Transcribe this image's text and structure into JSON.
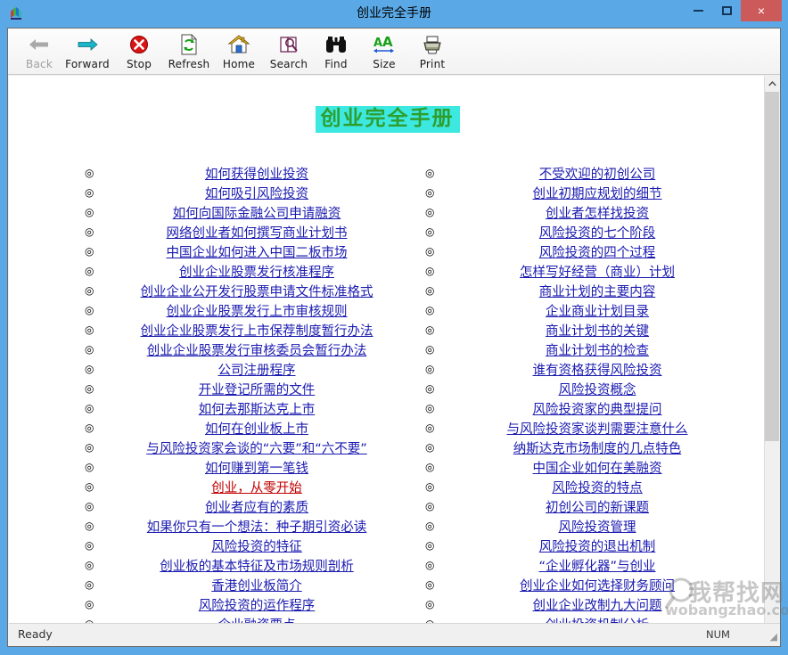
{
  "window": {
    "title": "创业完全手册",
    "icon": "html-help-book-icon",
    "minimize_label": "–",
    "maximize_label": "□",
    "close_label": "×"
  },
  "toolbar": {
    "items": [
      {
        "label": "Back",
        "icon": "arrow-left-icon",
        "disabled": true
      },
      {
        "label": "Forward",
        "icon": "arrow-right-icon",
        "disabled": false
      },
      {
        "label": "Stop",
        "icon": "stop-x-icon",
        "disabled": false
      },
      {
        "label": "Refresh",
        "icon": "refresh-page-icon",
        "disabled": false
      },
      {
        "label": "Home",
        "icon": "home-icon",
        "disabled": false
      },
      {
        "label": "Search",
        "icon": "search-book-icon",
        "disabled": false
      },
      {
        "label": "Find",
        "icon": "binoculars-icon",
        "disabled": false
      },
      {
        "label": "Size",
        "icon": "font-size-icon",
        "disabled": false
      },
      {
        "label": "Print",
        "icon": "printer-icon",
        "disabled": false
      }
    ]
  },
  "document": {
    "heading": "创业完全手册",
    "heading_background": "#3ce8e0",
    "heading_color": "#2f9e2f",
    "link_color": "#1a1ab0",
    "visited_link_color": "#c00000",
    "bullet_glyph": "◎",
    "left_column": [
      {
        "text": "如何获得创业投资",
        "visited": false
      },
      {
        "text": "如何吸引风险投资",
        "visited": false
      },
      {
        "text": "如何向国际金融公司申请融资",
        "visited": false
      },
      {
        "text": "网络创业者如何撰写商业计划书",
        "visited": false
      },
      {
        "text": "中国企业如何进入中国二板市场",
        "visited": false
      },
      {
        "text": "创业企业股票发行核准程序",
        "visited": false
      },
      {
        "text": "创业企业公开发行股票申请文件标准格式",
        "visited": false
      },
      {
        "text": "创业企业股票发行上市审核规则",
        "visited": false
      },
      {
        "text": "创业企业股票发行上市保荐制度暂行办法",
        "visited": false
      },
      {
        "text": "创业企业股票发行审核委员会暂行办法",
        "visited": false
      },
      {
        "text": "公司注册程序",
        "visited": false
      },
      {
        "text": "开业登记所需的文件",
        "visited": false
      },
      {
        "text": "如何去那斯达克上市",
        "visited": false
      },
      {
        "text": "如何在创业板上市",
        "visited": false
      },
      {
        "text": "与风险投资家会谈的“六要”和“六不要”",
        "visited": false
      },
      {
        "text": "如何赚到第一笔钱",
        "visited": false
      },
      {
        "text": "创业，从零开始",
        "visited": true
      },
      {
        "text": "创业者应有的素质",
        "visited": false
      },
      {
        "text": "如果你只有一个想法：种子期引资必读",
        "visited": false
      },
      {
        "text": "风险投资的特征",
        "visited": false
      },
      {
        "text": "创业板的基本特征及市场规则剖析",
        "visited": false
      },
      {
        "text": "香港创业板简介",
        "visited": false
      },
      {
        "text": "风险投资的运作程序",
        "visited": false
      },
      {
        "text": "企业融资要点",
        "visited": false
      }
    ],
    "right_column": [
      {
        "text": "不受欢迎的初创公司",
        "visited": false
      },
      {
        "text": "创业初期应规划的细节",
        "visited": false
      },
      {
        "text": "创业者怎样找投资",
        "visited": false
      },
      {
        "text": "风险投资的七个阶段",
        "visited": false
      },
      {
        "text": "风险投资的四个过程",
        "visited": false
      },
      {
        "text": "怎样写好经营（商业）计划",
        "visited": false
      },
      {
        "text": "商业计划的主要内容",
        "visited": false
      },
      {
        "text": "企业商业计划目录",
        "visited": false
      },
      {
        "text": "商业计划书的关键",
        "visited": false
      },
      {
        "text": "商业计划书的检查",
        "visited": false
      },
      {
        "text": "谁有资格获得风险投资",
        "visited": false
      },
      {
        "text": "风险投资概念",
        "visited": false
      },
      {
        "text": "风险投资家的典型提问",
        "visited": false
      },
      {
        "text": "与风险投资家谈判需要注意什么",
        "visited": false
      },
      {
        "text": "纳斯达克市场制度的几点特色",
        "visited": false
      },
      {
        "text": "中国企业如何在美融资",
        "visited": false
      },
      {
        "text": "风险投资的特点",
        "visited": false
      },
      {
        "text": "初创公司的新课题",
        "visited": false
      },
      {
        "text": "风险投资管理",
        "visited": false
      },
      {
        "text": "风险投资的退出机制",
        "visited": false
      },
      {
        "text": "“企业孵化器”与创业",
        "visited": false
      },
      {
        "text": "创业企业如何选择财务顾问",
        "visited": false
      },
      {
        "text": "创业企业改制九大问题",
        "visited": false
      },
      {
        "text": "创业投资机制分析",
        "visited": false
      }
    ]
  },
  "scrollbar": {
    "up_arrow": "▲",
    "down_arrow": "▼"
  },
  "statusbar": {
    "message": "Ready",
    "num_lock": "NUM",
    "grip": "◢"
  },
  "watermark": {
    "chinese": "我帮找网",
    "english": "wobangzhao.com",
    "icon": "magnifier-icon"
  }
}
